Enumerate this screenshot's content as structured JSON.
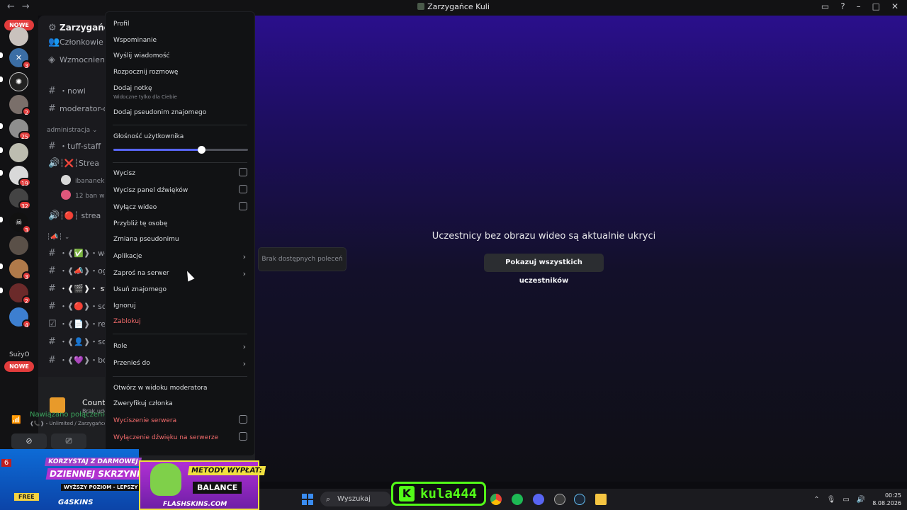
{
  "window": {
    "title": "Zarzygańce Kuli"
  },
  "rail": {
    "badge_top": "NOWE",
    "badge_bottom": "NOWE",
    "text_item": "SużyO",
    "servers": [
      {
        "badge": "3"
      },
      {
        "badge": ""
      },
      {
        "badge": "2"
      },
      {
        "badge": "25"
      },
      {
        "badge": ""
      },
      {
        "badge": "19"
      },
      {
        "badge": "32"
      },
      {
        "badge": "3"
      },
      {
        "badge": ""
      },
      {
        "badge": "3"
      },
      {
        "badge": "2"
      },
      {
        "badge": "4"
      }
    ]
  },
  "sidebar": {
    "server_name": "Zarzygańce K",
    "members": "Członkowie",
    "boosts": "Wzmocnienia",
    "channels": [
      {
        "name": "・nowi"
      },
      {
        "name": "moderator-or"
      },
      {
        "name": "・tuff-staff"
      },
      {
        "name": "┆❌┆Strea"
      },
      {
        "name": "┆🔴┆ strea"
      },
      {
        "name": "・❰✅❱・weryf"
      },
      {
        "name": "・❰📣❱・ogłos"
      },
      {
        "name": "・❰🎬❱・ strear"
      },
      {
        "name": "・❰🔴❱・social"
      },
      {
        "name": "・❰📄❱・regula"
      },
      {
        "name": "・❰👤❱・social"
      },
      {
        "name": "・❰💜❱・boost"
      }
    ],
    "category_admin": "administracja",
    "category_emoji": "┆📣┆",
    "voice_users": [
      "ibananekb",
      "12 ban w ty"
    ]
  },
  "activity": {
    "game": "Counter-Strike 2",
    "status": "Brak udostępniania"
  },
  "voice": {
    "status": "Nawiązano połączenie",
    "detail": "❰📞❱・Unlimited / Zarzygańce"
  },
  "main": {
    "message": "Uczestnicy bez obrazu wideo są aktualnie ukryci",
    "show_all_button": "Pokazuj wszystkich uczestników"
  },
  "menu": {
    "profile": "Profil",
    "mention": "Wspominanie",
    "send_message": "Wyślij wiadomość",
    "start_call": "Rozpocznij rozmowę",
    "add_note": "Dodaj notkę",
    "add_note_hint": "Widoczne tylko dla Ciebie",
    "add_nickname": "Dodaj pseudonim znajomego",
    "volume_label": "Głośność użytkownika",
    "volume_percent": 65,
    "mute": "Wycisz",
    "mute_soundboard": "Wycisz panel dźwięków",
    "disable_video": "Wyłącz wideo",
    "focus_person": "Przybliż tę osobę",
    "change_nickname": "Zmiana pseudonimu",
    "apps": "Aplikacje",
    "invite": "Zaproś na serwer",
    "remove_friend": "Usuń znajomego",
    "ignore": "Ignoruj",
    "block": "Zablokuj",
    "roles": "Role",
    "move_to": "Przenieś do",
    "open_mod_view": "Otwórz w widoku moderatora",
    "verify_member": "Zweryfikuj członka",
    "server_mute": "Wyciszenie serwera",
    "server_deafen": "Wyłączenie dźwięku na serwerze",
    "apps_submenu_empty": "Brak dostępnych poleceń"
  },
  "ads": {
    "left": {
      "line1": "KORZYSTAJ Z DARMOWEJ",
      "line2": "DZIENNEJ SKRZYNKI!",
      "line3": "WYŻSZY POZIOM - LEPSZY DROP",
      "free": "FREE",
      "brand": "G4SKINS",
      "counter": "6"
    },
    "right": {
      "line1": "METODY WYPŁAT:",
      "line2": "BALANCE",
      "brand": "FLASHSKINS.COM"
    }
  },
  "overlay": {
    "kick_name": "kula444",
    "kick_letter": "K"
  },
  "taskbar": {
    "search_placeholder": "Wyszukaj",
    "time": "00:25",
    "date": "8.08.2026"
  },
  "colors": {
    "accent": "#5865f2",
    "danger": "#f26b6b",
    "online": "#3ba55d",
    "kick": "#53fc18"
  }
}
